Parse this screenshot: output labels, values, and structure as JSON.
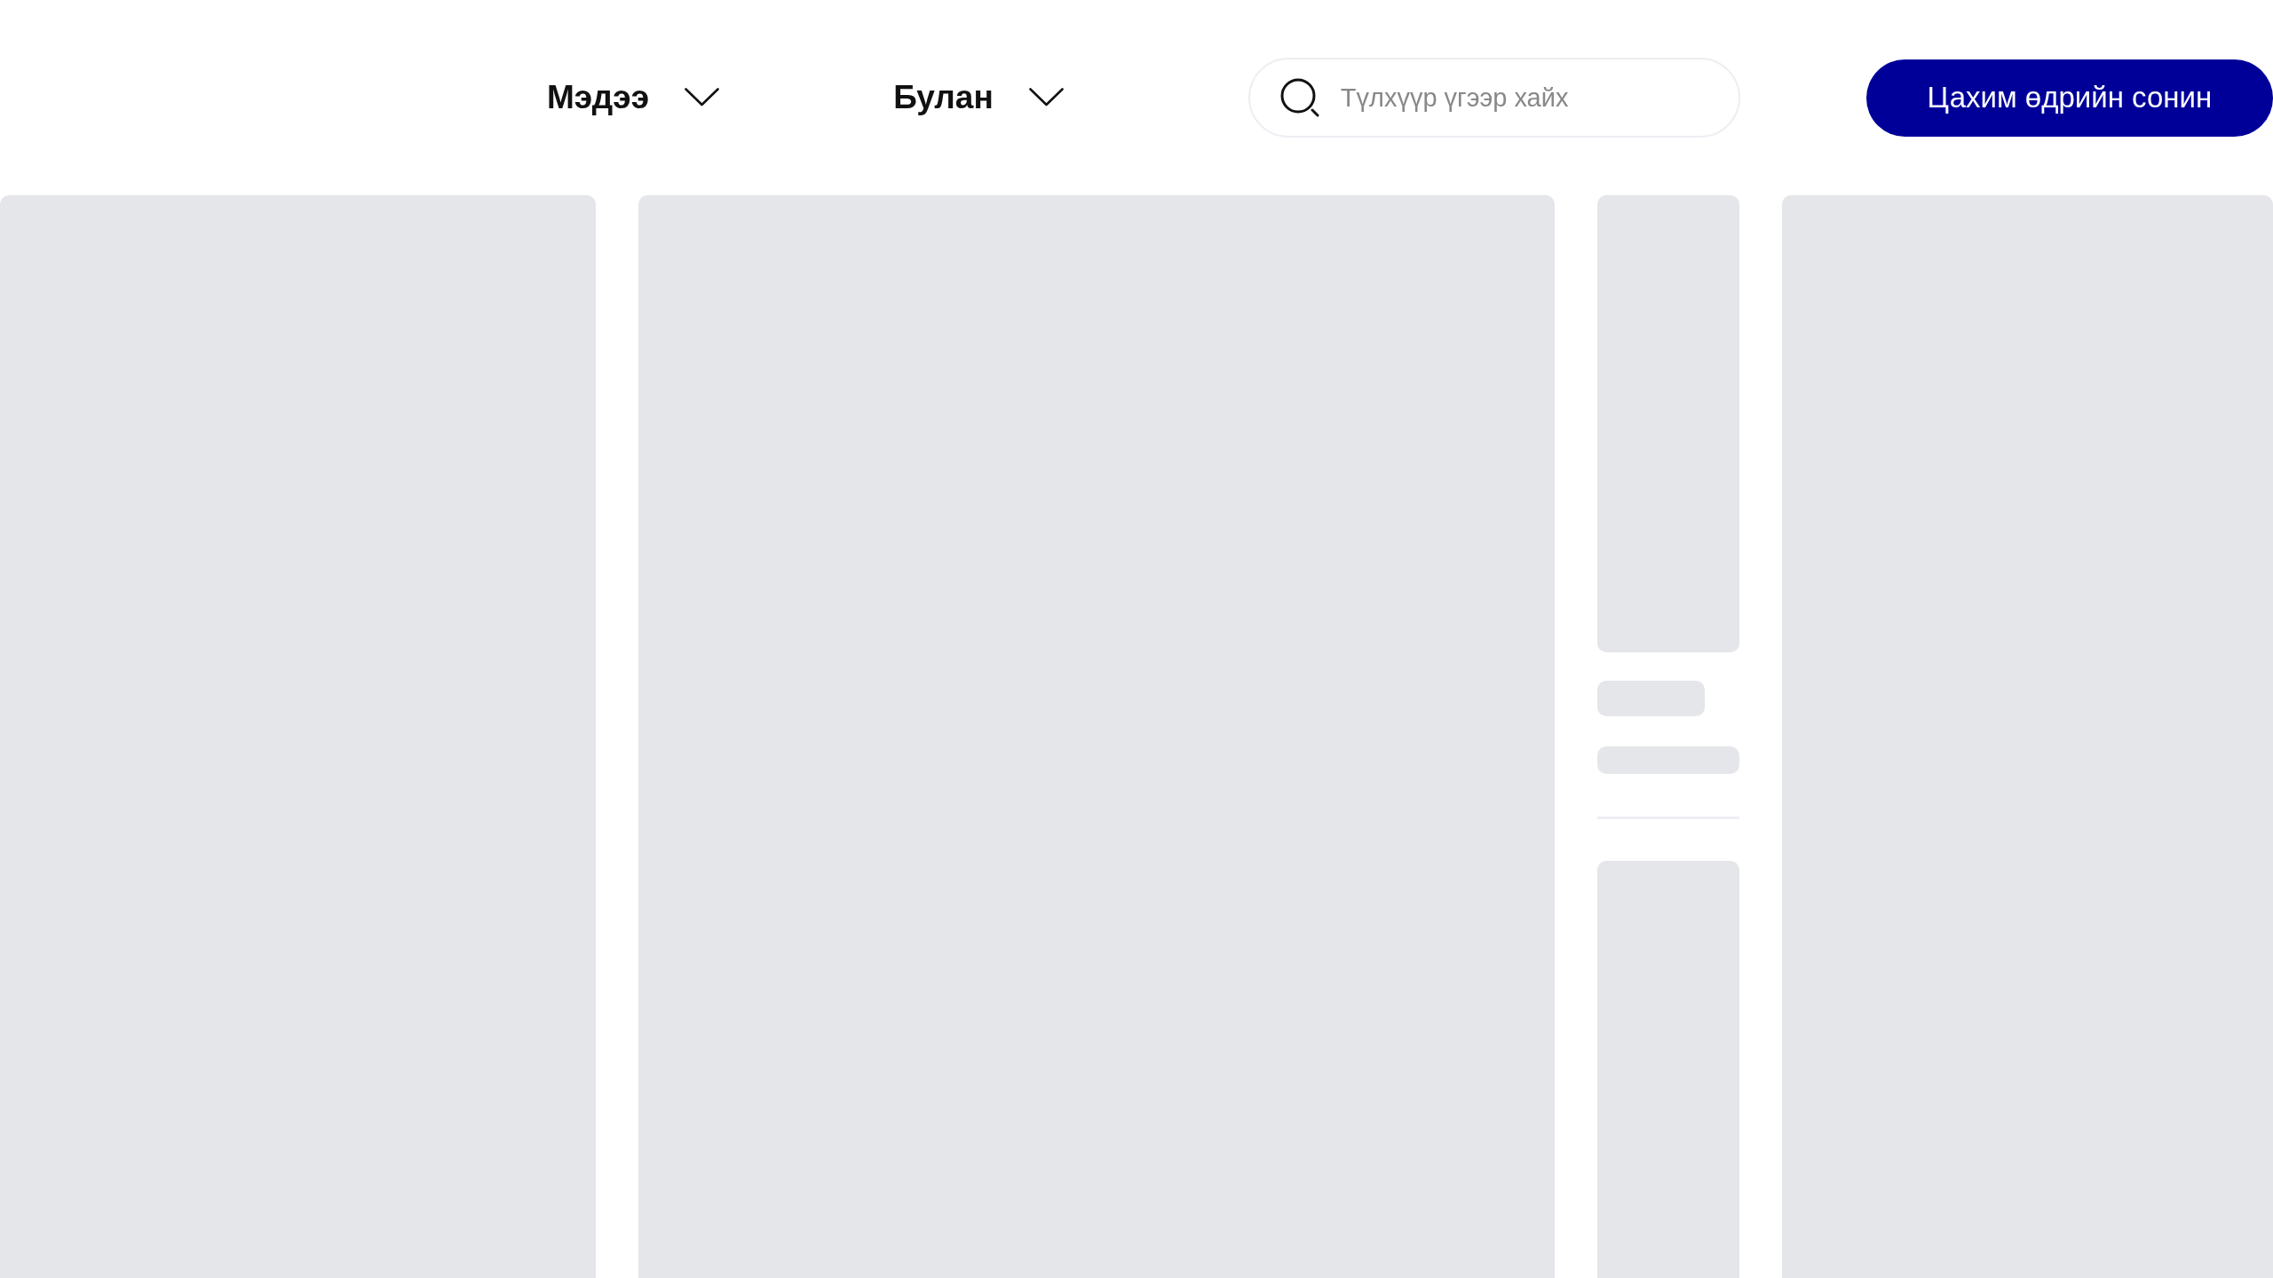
{
  "nav": [
    {
      "label": "Мэдээ"
    },
    {
      "label": "Булан"
    }
  ],
  "search": {
    "placeholder": "Түлхүүр үгээр хайх"
  },
  "buttons": [
    "Цахим өдрийн сонин"
  ]
}
